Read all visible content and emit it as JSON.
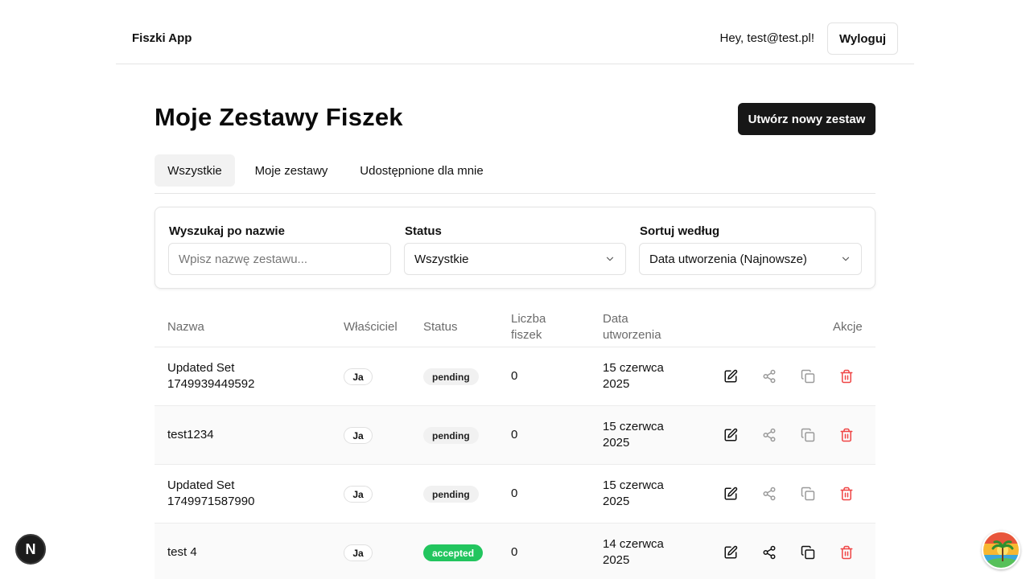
{
  "header": {
    "brand": "Fiszki App",
    "greeting": "Hey, test@test.pl!",
    "logout_label": "Wyloguj"
  },
  "page": {
    "title": "Moje Zestawy Fiszek",
    "create_label": "Utwórz nowy zestaw"
  },
  "tabs": [
    {
      "label": "Wszystkie",
      "active": true
    },
    {
      "label": "Moje zestawy",
      "active": false
    },
    {
      "label": "Udostępnione dla mnie",
      "active": false
    }
  ],
  "filters": {
    "search_label": "Wyszukaj po nazwie",
    "search_placeholder": "Wpisz nazwę zestawu...",
    "search_value": "",
    "status_label": "Status",
    "status_value": "Wszystkie",
    "sort_label": "Sortuj według",
    "sort_value": "Data utworzenia (Najnowsze)"
  },
  "table": {
    "headers": {
      "name": "Nazwa",
      "owner": "Właściciel",
      "status": "Status",
      "count_l1": "Liczba",
      "count_l2": "fiszek",
      "date_l1": "Data",
      "date_l2": "utworzenia",
      "actions": "Akcje"
    },
    "rows": [
      {
        "name_l1": "Updated Set",
        "name_l2": "1749939449592",
        "owner": "Ja",
        "status": "pending",
        "count": "0",
        "date_l1": "15 czerwca",
        "date_l2": "2025"
      },
      {
        "name_l1": "test1234",
        "name_l2": "",
        "owner": "Ja",
        "status": "pending",
        "count": "0",
        "date_l1": "15 czerwca",
        "date_l2": "2025"
      },
      {
        "name_l1": "Updated Set",
        "name_l2": "1749971587990",
        "owner": "Ja",
        "status": "pending",
        "count": "0",
        "date_l1": "15 czerwca",
        "date_l2": "2025"
      },
      {
        "name_l1": "test 4",
        "name_l2": "",
        "owner": "Ja",
        "status": "accepted",
        "count": "0",
        "date_l1": "14 czerwca",
        "date_l2": "2025"
      }
    ]
  },
  "colors": {
    "primary": "#171717",
    "accepted": "#22c55e",
    "delete": "#ef4444",
    "muted_icon": "#9a9a9a"
  },
  "icons": {
    "edit": "edit-icon",
    "share": "share-icon",
    "copy": "copy-icon",
    "delete": "trash-icon"
  },
  "corner": {
    "dev_badge": "N"
  }
}
